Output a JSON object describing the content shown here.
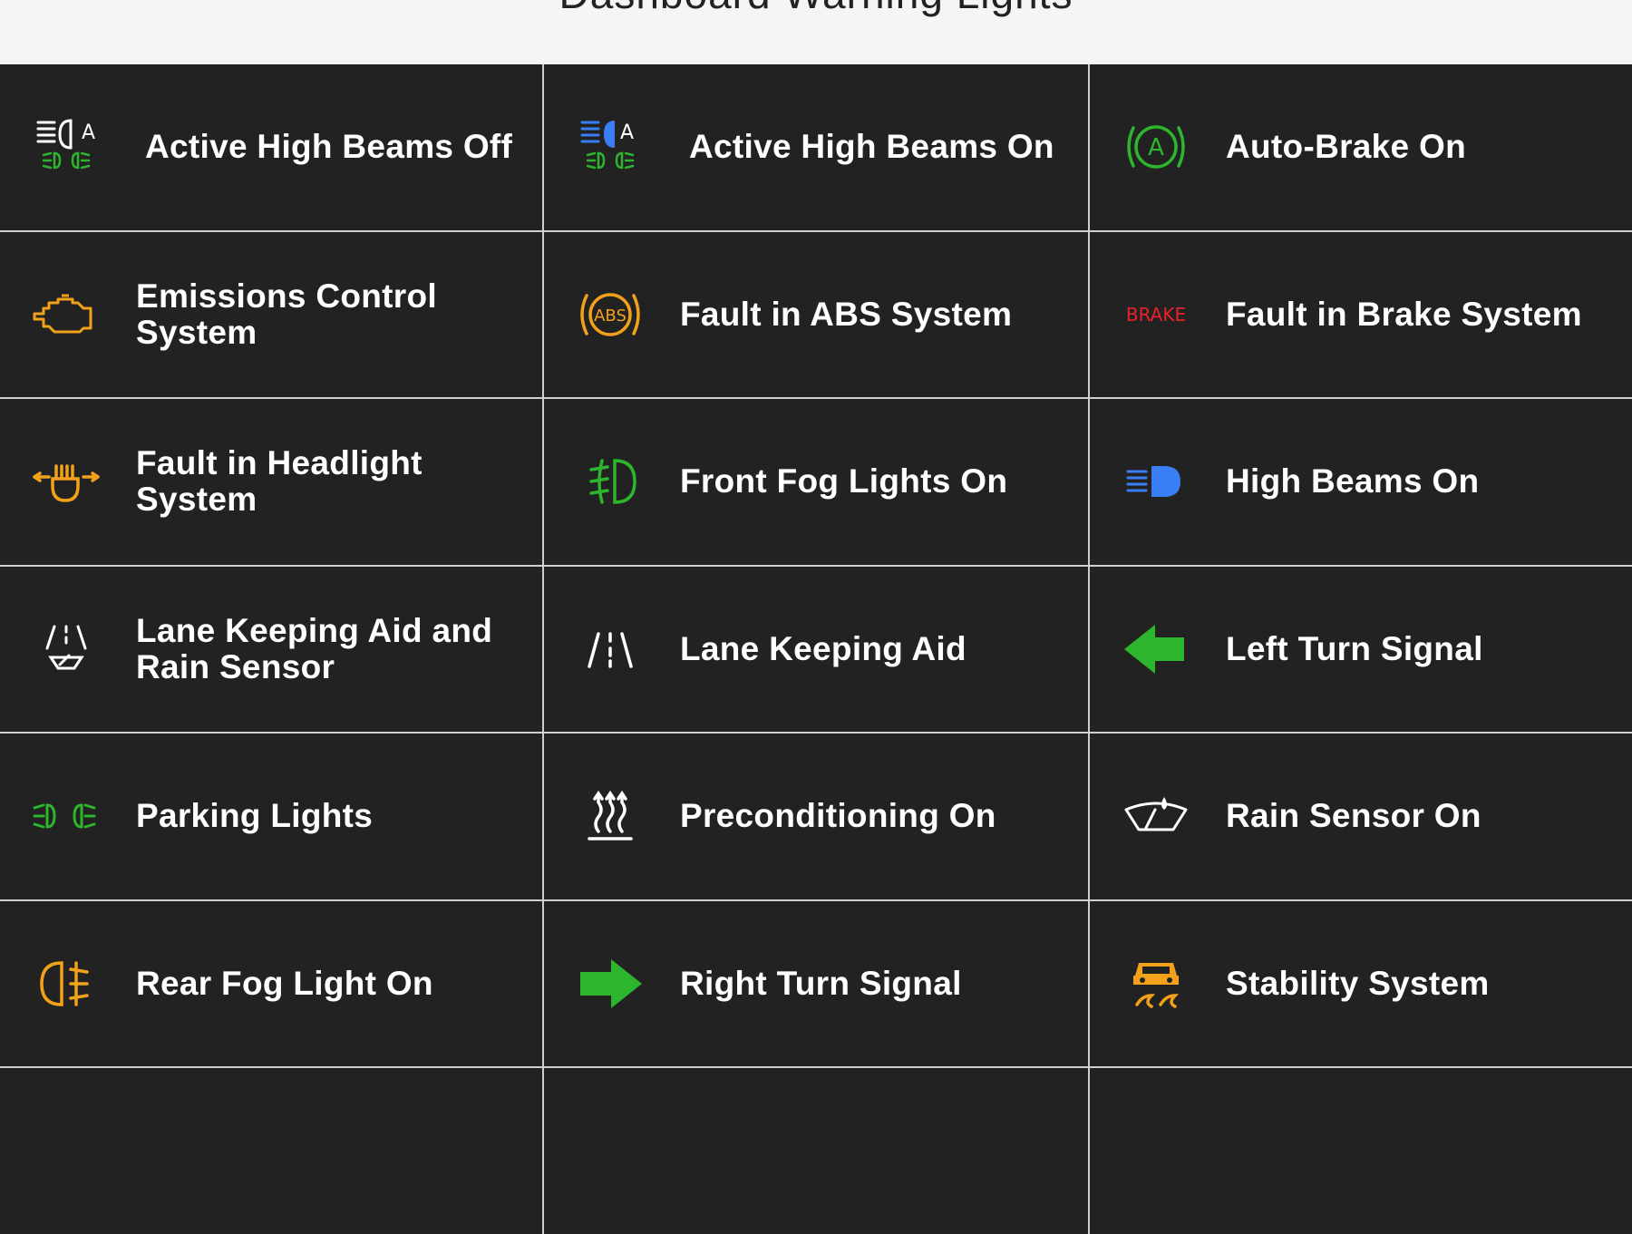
{
  "page": {
    "title": "Dashboard Warning Lights"
  },
  "colors": {
    "background": "#222222",
    "grid_line": "#cfcfcf",
    "header_bg": "#f5f5f5",
    "green": "#2db52d",
    "orange": "#f2a21a",
    "red": "#e8222a",
    "blue": "#3a7ef5",
    "white": "#ffffff"
  },
  "lights": [
    {
      "label": "Active High Beams Off",
      "icon": "auto-high-beam-off-icon"
    },
    {
      "label": "Active High Beams On",
      "icon": "auto-high-beam-on-icon"
    },
    {
      "label": "Auto-Brake On",
      "icon": "auto-brake-icon"
    },
    {
      "label": "Emissions Control System",
      "icon": "engine-icon"
    },
    {
      "label": "Fault in ABS System",
      "icon": "abs-icon",
      "icon_text": "ABS"
    },
    {
      "label": "Fault in Brake System",
      "icon": "brake-text-icon",
      "icon_text": "BRAKE"
    },
    {
      "label": "Fault in Headlight System",
      "icon": "headlight-fault-icon"
    },
    {
      "label": "Front Fog Lights On",
      "icon": "front-fog-icon"
    },
    {
      "label": "High Beams On",
      "icon": "high-beam-icon"
    },
    {
      "label": "Lane Keeping Aid and Rain Sensor",
      "icon": "lane-rain-icon"
    },
    {
      "label": "Lane Keeping Aid",
      "icon": "lane-keeping-icon"
    },
    {
      "label": "Left Turn Signal",
      "icon": "left-arrow-icon"
    },
    {
      "label": "Parking Lights",
      "icon": "parking-lights-icon"
    },
    {
      "label": "Preconditioning On",
      "icon": "heat-waves-icon"
    },
    {
      "label": "Rain Sensor On",
      "icon": "rain-sensor-icon"
    },
    {
      "label": "Rear Fog Light On",
      "icon": "rear-fog-icon"
    },
    {
      "label": "Right Turn Signal",
      "icon": "right-arrow-icon"
    },
    {
      "label": "Stability System",
      "icon": "stability-icon"
    }
  ]
}
